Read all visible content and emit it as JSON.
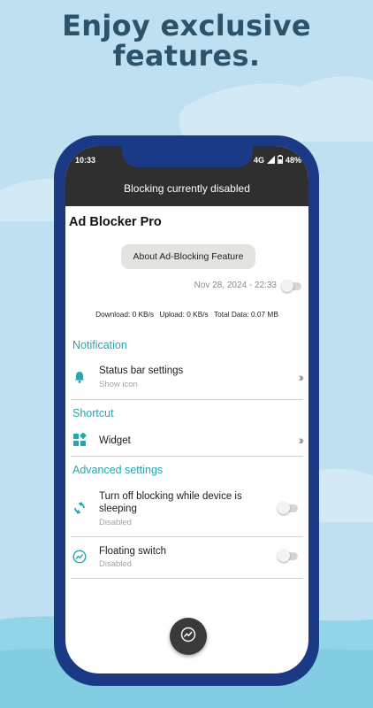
{
  "promo": {
    "headline_line1": "Enjoy exclusive",
    "headline_line2": "features."
  },
  "status_bar": {
    "time": "10:33",
    "network": "4G",
    "battery": "48%"
  },
  "app_bar": {
    "status_text": "Blocking currently disabled"
  },
  "app": {
    "title": "Ad Blocker Pro",
    "about_button": "About Ad-Blocking Feature",
    "date": "Nov 28, 2024 - 22:33",
    "blocking_enabled": false,
    "stats": {
      "download": "Download: 0 KB/s",
      "upload": "Upload: 0 KB/s",
      "total": "Total Data: 0.07 MB"
    }
  },
  "sections": {
    "notification": {
      "header": "Notification",
      "status_bar_settings": {
        "title": "Status bar settings",
        "subtitle": "Show icon",
        "icon": "bell-icon"
      }
    },
    "shortcut": {
      "header": "Shortcut",
      "widget": {
        "title": "Widget",
        "icon": "widgets-icon"
      }
    },
    "advanced": {
      "header": "Advanced settings",
      "sleep_blocking": {
        "title_line1": "Turn off blocking while device is",
        "title_line2": "sleeping",
        "subtitle": "Disabled",
        "enabled": false,
        "icon": "sync-icon"
      },
      "floating_switch": {
        "title": "Floating switch",
        "subtitle": "Disabled",
        "enabled": false,
        "icon": "floating-switch-icon"
      }
    }
  },
  "fab": {
    "icon": "speed-chart-icon"
  },
  "colors": {
    "accent": "#26a7b0",
    "phone_frame": "#1a3a86",
    "app_bar": "#2f2f2f",
    "background": "#bfe0f1",
    "headline": "#2b5369"
  }
}
